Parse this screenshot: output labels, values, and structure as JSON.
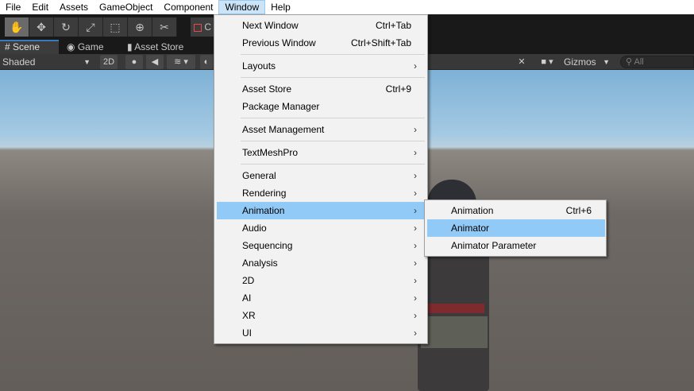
{
  "menubar": {
    "items": [
      "File",
      "Edit",
      "Assets",
      "GameObject",
      "Component",
      "Window",
      "Help"
    ]
  },
  "toolbar": {
    "tools": [
      {
        "icon": "hand-icon",
        "glyph": "✋"
      },
      {
        "icon": "move-icon",
        "glyph": "✥"
      },
      {
        "icon": "rotate-icon",
        "glyph": "↻"
      },
      {
        "icon": "scale-icon",
        "glyph": "⤢"
      },
      {
        "icon": "rect-tool-icon",
        "glyph": "⬚"
      },
      {
        "icon": "transform-tool-icon",
        "glyph": "⊕"
      },
      {
        "icon": "custom-tool-icon",
        "glyph": "✂"
      }
    ],
    "pivot_label": "C"
  },
  "tabs": [
    {
      "label": "Scene",
      "icon": "grid-icon",
      "glyph": "#"
    },
    {
      "label": "Game",
      "icon": "gamepad-icon",
      "glyph": "◉"
    },
    {
      "label": "Asset Store",
      "icon": "bag-icon",
      "glyph": "▮"
    }
  ],
  "scenebar": {
    "shading_mode": "Shaded",
    "toggle_2d": "2D",
    "gizmos": "Gizmos",
    "search_placeholder": "All"
  },
  "window_menu": {
    "items": [
      {
        "label": "Next Window",
        "shortcut": "Ctrl+Tab"
      },
      {
        "label": "Previous Window",
        "shortcut": "Ctrl+Shift+Tab"
      },
      {
        "label": "Layouts",
        "submenu": true
      },
      {
        "label": "Asset Store",
        "shortcut": "Ctrl+9"
      },
      {
        "label": "Package Manager"
      },
      {
        "label": "Asset Management",
        "submenu": true
      },
      {
        "label": "TextMeshPro",
        "submenu": true
      },
      {
        "label": "General",
        "submenu": true
      },
      {
        "label": "Rendering",
        "submenu": true
      },
      {
        "label": "Animation",
        "submenu": true
      },
      {
        "label": "Audio",
        "submenu": true
      },
      {
        "label": "Sequencing",
        "submenu": true
      },
      {
        "label": "Analysis",
        "submenu": true
      },
      {
        "label": "2D",
        "submenu": true
      },
      {
        "label": "AI",
        "submenu": true
      },
      {
        "label": "XR",
        "submenu": true
      },
      {
        "label": "UI",
        "submenu": true
      }
    ]
  },
  "animation_submenu": {
    "items": [
      {
        "label": "Animation",
        "shortcut": "Ctrl+6"
      },
      {
        "label": "Animator"
      },
      {
        "label": "Animator Parameter"
      }
    ]
  },
  "chevron_glyph": "›",
  "colors": {
    "highlight": "#91c9f7",
    "menubar_active": "#cce4f7",
    "tab_accent": "#3a79bb"
  }
}
